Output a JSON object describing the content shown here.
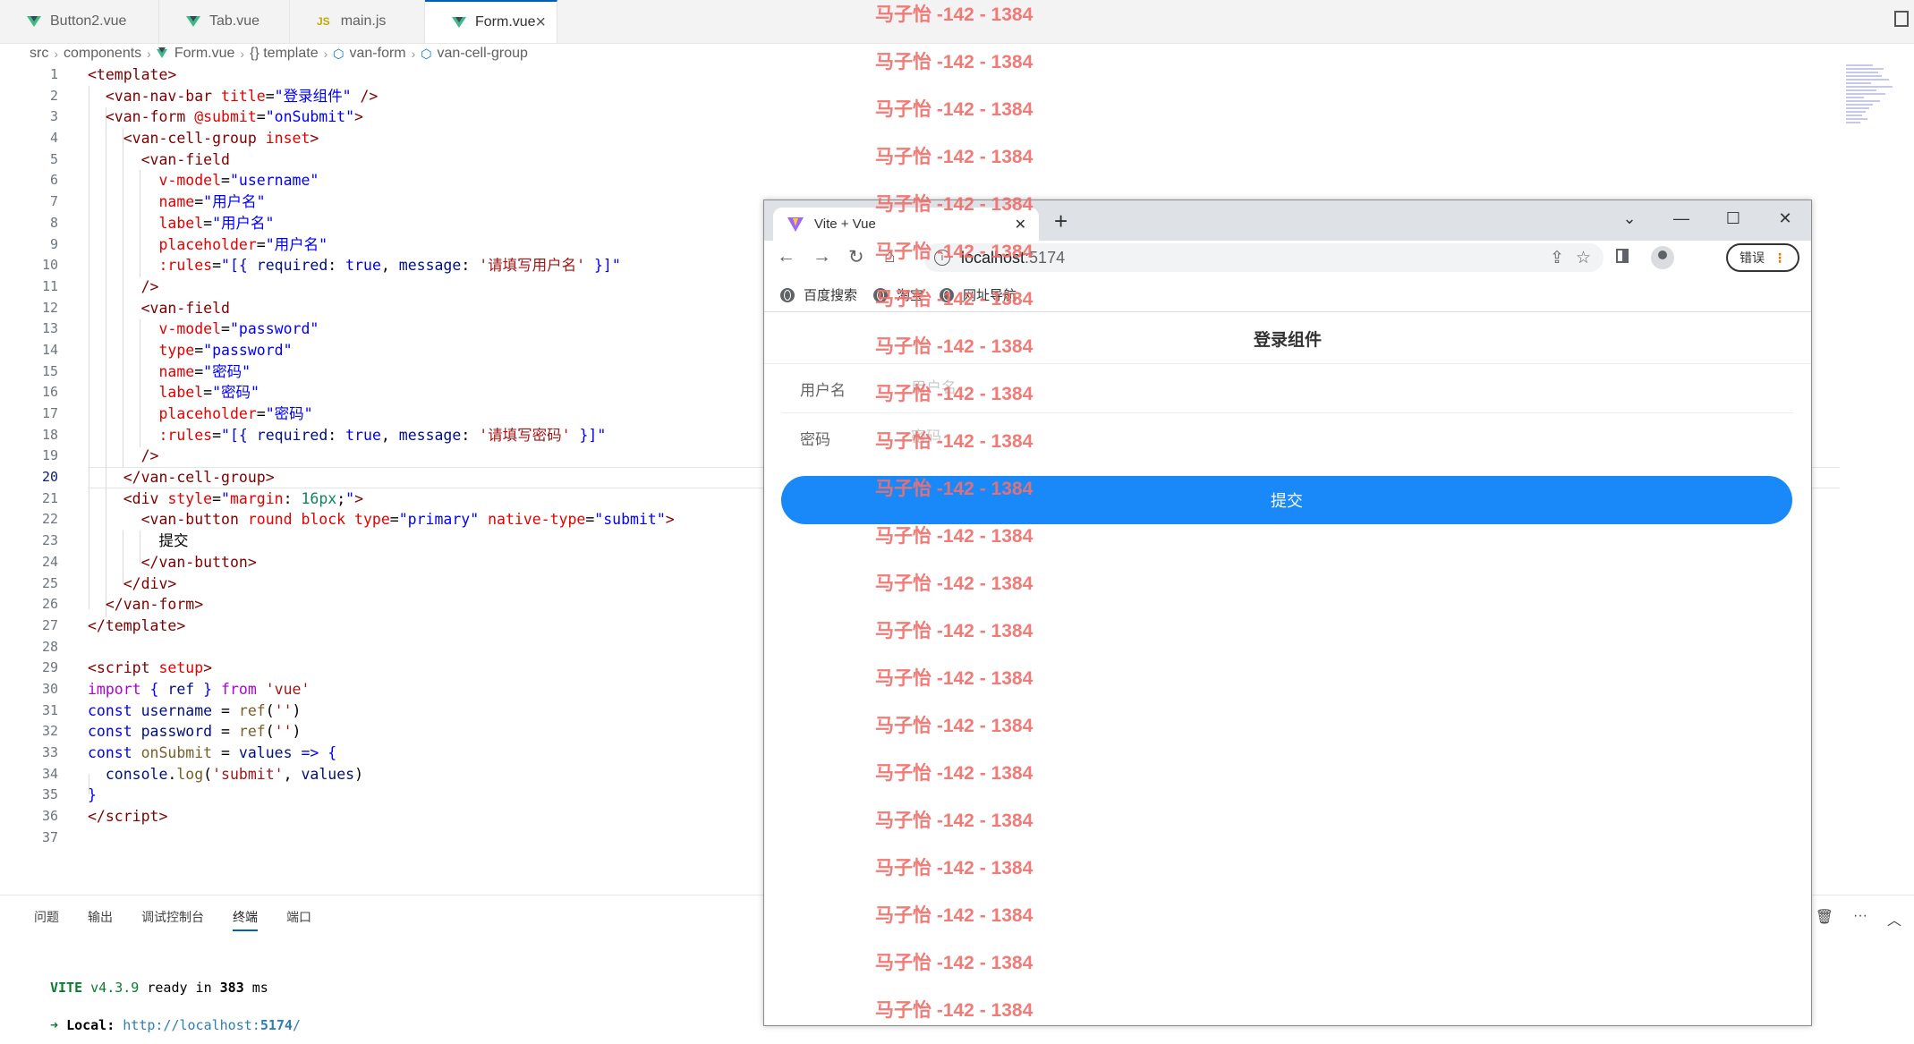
{
  "editor": {
    "tabs": [
      {
        "label": "Button2.vue",
        "icon": "vue-icon"
      },
      {
        "label": "Tab.vue",
        "icon": "vue-icon"
      },
      {
        "label": "main.js",
        "icon": "js-icon",
        "badge": "JS"
      },
      {
        "label": "Form.vue",
        "icon": "vue-icon",
        "active": true
      }
    ],
    "breadcrumb": [
      "src",
      "components",
      "Form.vue",
      "{} template",
      "van-form",
      "van-cell-group"
    ],
    "line_numbers": [
      "1",
      "2",
      "3",
      "4",
      "5",
      "6",
      "7",
      "8",
      "9",
      "10",
      "11",
      "12",
      "13",
      "14",
      "15",
      "16",
      "17",
      "18",
      "19",
      "20",
      "21",
      "22",
      "23",
      "24",
      "25",
      "26",
      "27",
      "28",
      "29",
      "30",
      "31",
      "32",
      "33",
      "34",
      "35",
      "36",
      "37"
    ],
    "current_line": "20"
  },
  "panel": {
    "tabs": [
      "问题",
      "输出",
      "调试控制台",
      "终端",
      "端口"
    ],
    "active_tab": "终端",
    "terminal": {
      "vite_label": "VITE",
      "vite_version": "v4.3.9",
      "ready_text": "ready in",
      "ready_ms": "383",
      "ready_unit": "ms",
      "arrow": "➜",
      "local_label": "Local:",
      "local_url_prefix": "http://localhost:",
      "local_port": "5174",
      "local_url_suffix": "/"
    }
  },
  "browser": {
    "tab_title": "Vite + Vue",
    "url_host": "localhost",
    "url_port": ":5174",
    "error_button": "错误",
    "bookmarks": [
      "百度搜索",
      "淘宝",
      "网址导航"
    ],
    "page": {
      "nav_title": "登录组件",
      "fields": [
        {
          "label": "用户名",
          "placeholder": "用户名"
        },
        {
          "label": "密码",
          "placeholder": "密码"
        }
      ],
      "submit_label": "提交"
    }
  },
  "watermark": {
    "text": "马子怡 -142 - 1384",
    "color": "#f0706c"
  },
  "colors": {
    "accent": "#005fb8",
    "button_primary": "#1989fa",
    "vue_green": "#41b883"
  }
}
